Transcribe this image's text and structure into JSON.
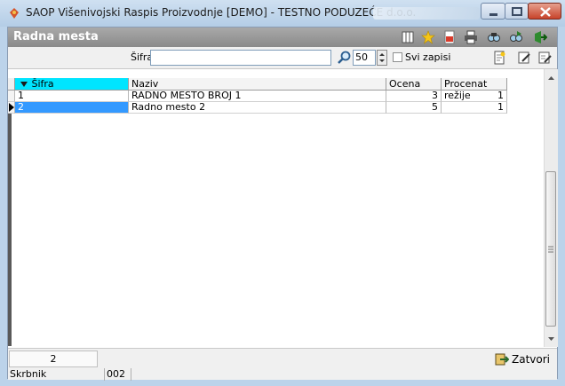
{
  "window": {
    "title": "SAOP Višenivojski Raspis Proizvodnje [DEMO] - TESTNO PODUZEĆE d.o.o."
  },
  "header": {
    "title": "Radna mesta",
    "toolbar_icons": [
      "columns-icon",
      "favorite-star-icon",
      "pdf-export-icon",
      "print-icon",
      "find-icon",
      "find-next-icon",
      "exit-icon"
    ]
  },
  "filter": {
    "label": "Šifra",
    "value": "",
    "page_size": "50",
    "all_records_label": "Svi zapisi",
    "all_records_checked": false
  },
  "table": {
    "columns": [
      "Šifra",
      "Naziv",
      "Ocena",
      "Procenat režije"
    ],
    "rows": [
      {
        "sifra": "1",
        "naziv": "RADNO MESTO BROJ 1",
        "ocena": "3",
        "procenat": "1"
      },
      {
        "sifra": "2",
        "naziv": "Radno mesto 2",
        "ocena": "5",
        "procenat": "1"
      }
    ],
    "selected_row": 1
  },
  "footer": {
    "record_count": "2",
    "close_label": "Zatvori"
  },
  "statusbar": {
    "user_label": "Skrbnik",
    "user_code": "002"
  },
  "colors": {
    "accent": "#3399ff",
    "header_bg": "#9a9a9a",
    "sort_column": "#00e5ff"
  }
}
